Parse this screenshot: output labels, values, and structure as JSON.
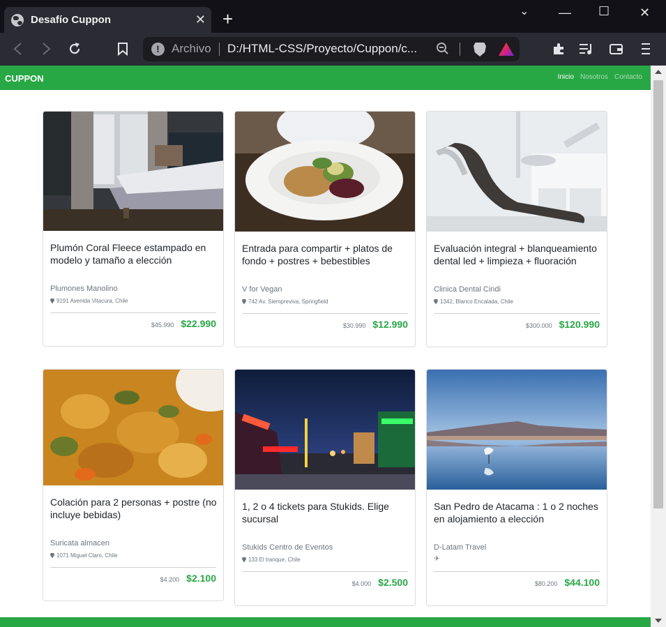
{
  "browser": {
    "tab_title": "Desafío Cuppon",
    "tab_close": "✕",
    "new_tab": "+",
    "window_minimize": "—",
    "window_maximize": "☐",
    "window_close": "✕",
    "window_menu": "⌄",
    "address_label": "Archivo",
    "address_info": "!",
    "url": "D:/HTML-CSS/Proyecto/Cuppon/c..."
  },
  "navbar": {
    "brand": "CUPPON",
    "links": [
      {
        "label": "Inicio"
      },
      {
        "label": "Nosotros"
      },
      {
        "label": "Contacto"
      }
    ]
  },
  "cards": [
    {
      "title": "Plumón Coral Fleece estampado en modelo y tamaño a elección",
      "vendor": "Plumones Manolino",
      "address": "9191 Avenida Vitacura, Chile",
      "old_price": "$45.990",
      "new_price": "$22.990"
    },
    {
      "title": "Entrada para compartir + platos de fondo + postres + bebestibles",
      "vendor": "V for Vegan",
      "address": "742 Av. Siempreviva, Springfield",
      "old_price": "$30.990",
      "new_price": "$12.990"
    },
    {
      "title": "Evaluación integral + blanqueamiento dental led + limpieza + fluoración",
      "vendor": "Clinica Dental Cindi",
      "address": "1342, Blanco Encalada, Chile",
      "old_price": "$300.000",
      "new_price": "$120.990"
    },
    {
      "title": "Colación para 2 personas + postre (no incluye bebidas)",
      "vendor": "Suricata almacen",
      "address": "1071 Miguel Claro, Chile",
      "old_price": "$4.200",
      "new_price": "$2.100"
    },
    {
      "title": "1, 2 o 4 tickets para Stukids. Elige sucursal",
      "vendor": "Stukids Centro de Eventos",
      "address": "133 El tranque, Chile",
      "old_price": "$4.000",
      "new_price": "$2.500"
    },
    {
      "title": "San Pedro de Atacama : 1 o 2 noches en alojamiento a elección",
      "vendor": "D-Latam Travel",
      "address": "",
      "old_price": "$80.200",
      "new_price": "$44.100"
    }
  ],
  "colors": {
    "brand_green": "#28a745",
    "chrome_dark": "#111117",
    "chrome_toolbar": "#2b2c33"
  }
}
